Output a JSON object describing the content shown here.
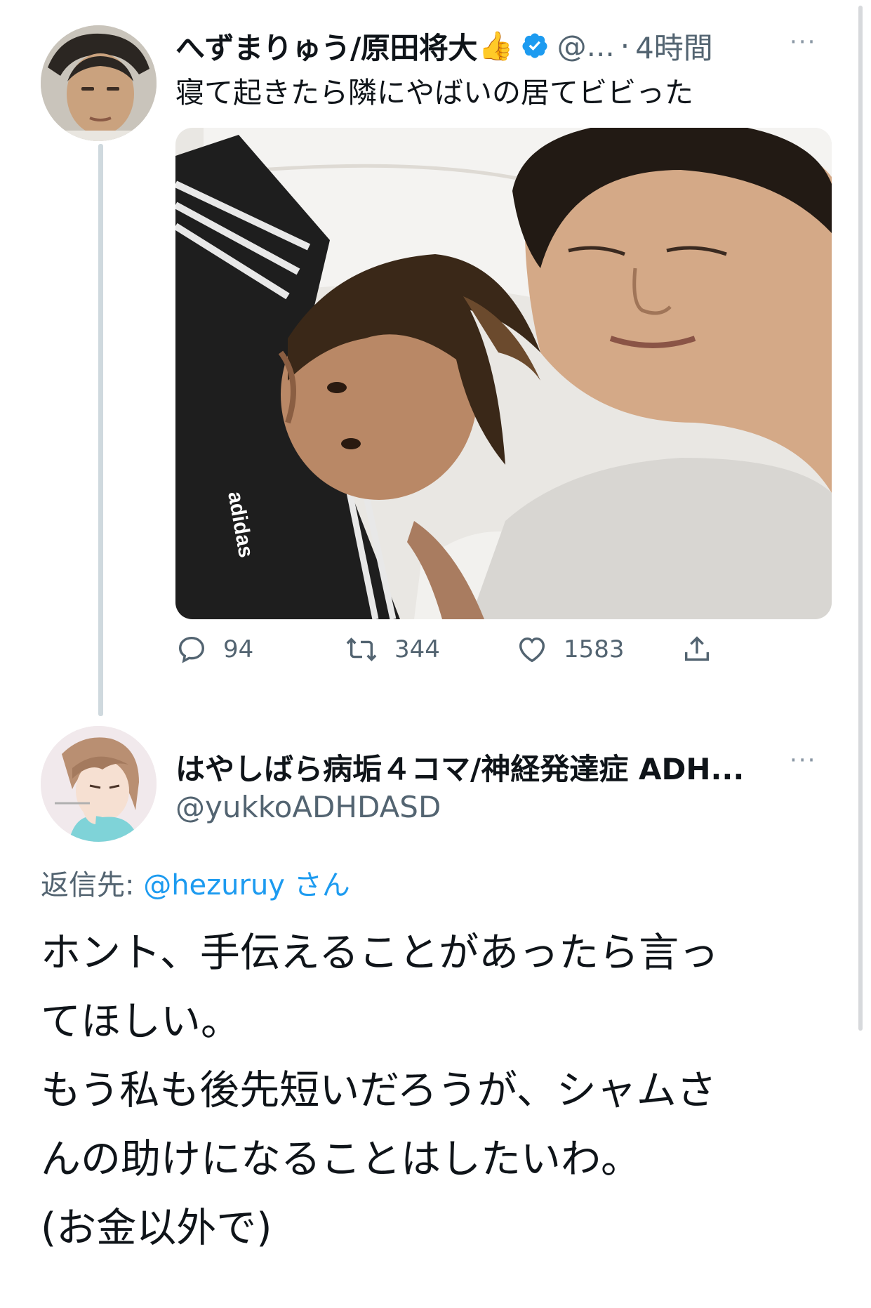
{
  "tweet": {
    "author_name": "へずまりゅう/原田将大",
    "name_emoji": "👍",
    "handle": "@...",
    "separator": "·",
    "time": "4時間",
    "more": "···",
    "text": "寝て起きたら隣にやばいの居てビビった",
    "photo_text": "adidas",
    "actions": {
      "replies": "94",
      "retweets": "344",
      "likes": "1583"
    }
  },
  "reply": {
    "author_name": "はやしばら病垢４コマ/神経発達症 ADH...",
    "handle": "@yukkoADHDASD",
    "more": "···",
    "reply_to_label": "返信先:",
    "reply_to_handle": "@hezuruy",
    "reply_to_suffix": "さん",
    "lines": [
      "ホント、手伝えることがあったら言っ",
      "てほしい。",
      "もう私も後先短いだろうが、シャムさ",
      "んの助けになることはしたいわ。",
      "(お金以外で)"
    ]
  },
  "colors": {
    "text": "#0f1419",
    "muted": "#536471",
    "link": "#1d9bf0",
    "verified": "#1d9bf0",
    "thread_line": "#cfd9de"
  },
  "icons": [
    "verified-badge-icon",
    "reply-icon",
    "retweet-icon",
    "like-icon",
    "share-icon",
    "more-icon"
  ]
}
